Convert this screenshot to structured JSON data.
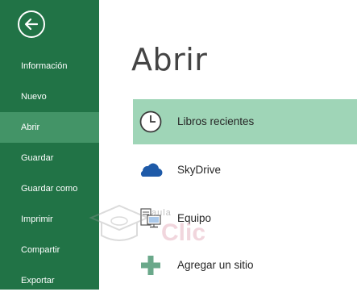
{
  "sidebar": {
    "items": [
      {
        "label": "Información"
      },
      {
        "label": "Nuevo"
      },
      {
        "label": "Abrir"
      },
      {
        "label": "Guardar"
      },
      {
        "label": "Guardar como"
      },
      {
        "label": "Imprimir"
      },
      {
        "label": "Compartir"
      },
      {
        "label": "Exportar"
      }
    ],
    "active": "Abrir"
  },
  "main": {
    "title": "Abrir",
    "options": [
      {
        "label": "Libros recientes",
        "icon": "clock-icon"
      },
      {
        "label": "SkyDrive",
        "icon": "cloud-icon"
      },
      {
        "label": "Equipo",
        "icon": "computer-icon"
      },
      {
        "label": "Agregar un sitio",
        "icon": "plus-icon"
      }
    ]
  },
  "watermark": {
    "line1": "aula",
    "line2": "Clic"
  },
  "colors": {
    "sidebar": "#217346",
    "sidebar_active": "#439467",
    "selected_option": "#9fd5b7",
    "skydrive_blue": "#1e5aa8",
    "plus_green": "#6aa88a"
  }
}
